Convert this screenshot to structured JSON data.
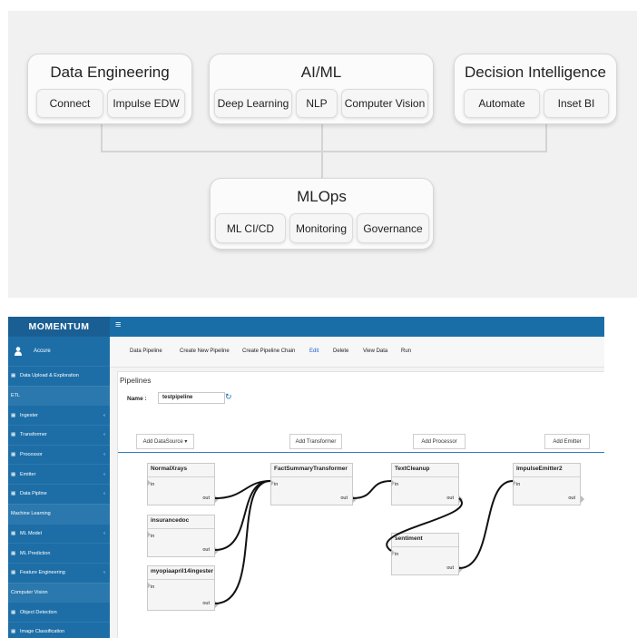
{
  "architecture": {
    "groups": [
      {
        "title": "Data Engineering",
        "items": [
          "Connect",
          "Impulse EDW"
        ]
      },
      {
        "title": "AI/ML",
        "items": [
          "Deep Learning",
          "NLP",
          "Computer Vision"
        ]
      },
      {
        "title": "Decision Intelligence",
        "items": [
          "Automate",
          "Inset BI"
        ]
      },
      {
        "title": "MLOps",
        "items": [
          "ML CI/CD",
          "Monitoring",
          "Governance"
        ]
      }
    ]
  },
  "app": {
    "brand": "MOMENTUM",
    "user": "Accure",
    "sidebar": [
      {
        "type": "item",
        "label": "Data Upload & Exploration",
        "icon": "grid-icon",
        "chevron": false
      },
      {
        "type": "section",
        "label": "ETL"
      },
      {
        "type": "item",
        "label": "Ingester",
        "icon": "grid-icon",
        "chevron": true
      },
      {
        "type": "item",
        "label": "Transformer",
        "icon": "grid-icon",
        "chevron": true
      },
      {
        "type": "item",
        "label": "Processor",
        "icon": "grid-icon",
        "chevron": true
      },
      {
        "type": "item",
        "label": "Emitter",
        "icon": "grid-icon",
        "chevron": true
      },
      {
        "type": "item",
        "label": "Data Pipline",
        "icon": "grid-icon",
        "chevron": true
      },
      {
        "type": "section",
        "label": "Machine Learning"
      },
      {
        "type": "item",
        "label": "ML Model",
        "icon": "grid-icon",
        "chevron": true
      },
      {
        "type": "item",
        "label": "ML Prediction",
        "icon": "grid-icon",
        "chevron": false
      },
      {
        "type": "item",
        "label": "Feature Engineering",
        "icon": "grid-icon",
        "chevron": true
      },
      {
        "type": "section",
        "label": "Computer Vision"
      },
      {
        "type": "item",
        "label": "Object Detection",
        "icon": "grid-icon",
        "chevron": false
      },
      {
        "type": "item",
        "label": "Image Classification",
        "icon": "grid-icon",
        "chevron": false
      }
    ],
    "nav": [
      "Data Pipeline",
      "Create New Pipeline",
      "Create Pipeline Chain",
      "Edit",
      "Delete",
      "View Data",
      "Run"
    ],
    "active_nav": "Edit",
    "accent_color": "#1a6ea8",
    "panel_title": "Pipelines",
    "name_label": "Name :",
    "name_value": "testpipeline",
    "add_buttons": [
      "Add DataSource ▾",
      "Add Transformer",
      "Add Processor",
      "Add Emitter"
    ],
    "port_in": "in",
    "port_out": "out",
    "nodes": [
      {
        "id": "n1",
        "title": "NormalXrays"
      },
      {
        "id": "n2",
        "title": "insurancedoc"
      },
      {
        "id": "n3",
        "title": "myopiaapril14ingester"
      },
      {
        "id": "n4",
        "title": "FactSummaryTransformer"
      },
      {
        "id": "n5",
        "title": "TextCleanup"
      },
      {
        "id": "n6",
        "title": "sentiment"
      },
      {
        "id": "n7",
        "title": "ImpulseEmitter2"
      }
    ]
  }
}
